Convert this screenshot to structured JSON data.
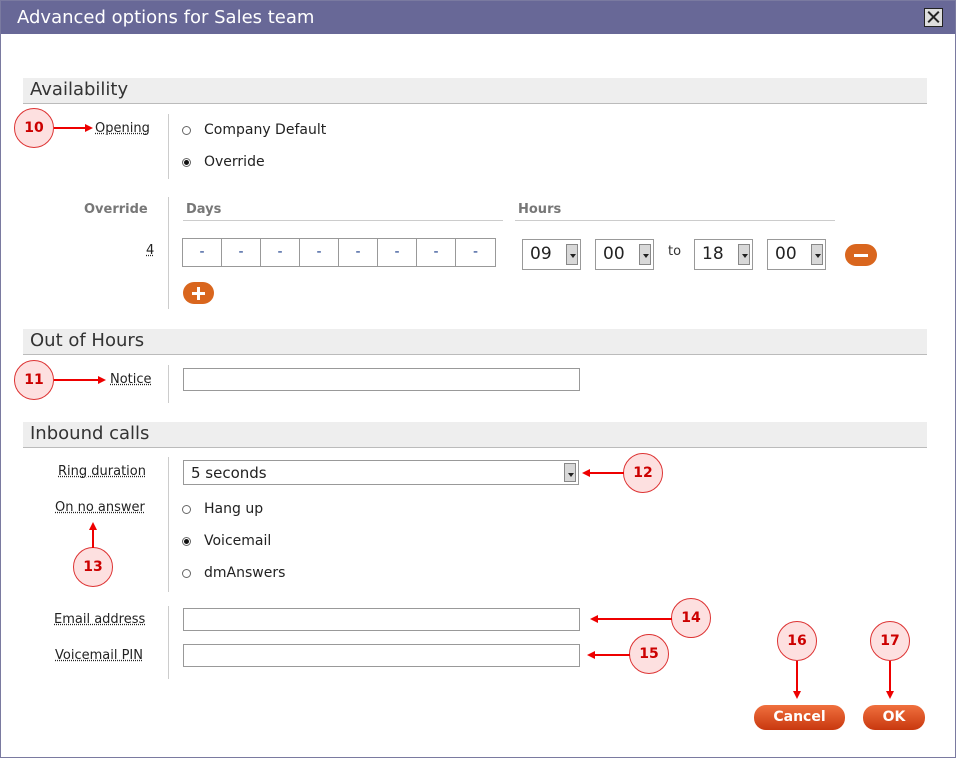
{
  "dialog": {
    "title": "Advanced options for Sales team"
  },
  "availability": {
    "heading": "Availability",
    "opening_label": "Opening",
    "options": [
      "Company Default",
      "Override"
    ],
    "selected": "Override",
    "override_label": "Override",
    "days_header": "Days",
    "hours_header": "Hours",
    "row_number": "4",
    "days": [
      "-",
      "-",
      "-",
      "-",
      "-",
      "-",
      "-",
      "-"
    ],
    "from_hour": "09",
    "from_minute": "00",
    "to_label": "to",
    "to_hour": "18",
    "to_minute": "00"
  },
  "out_of_hours": {
    "heading": "Out of Hours",
    "notice_label": "Notice",
    "notice_value": ""
  },
  "inbound": {
    "heading": "Inbound calls",
    "ring_label": "Ring duration",
    "ring_value": "5 seconds",
    "no_answer_label": "On no answer",
    "options": [
      "Hang up",
      "Voicemail",
      "dmAnswers"
    ],
    "selected": "Voicemail",
    "email_label": "Email address",
    "email_value": "",
    "pin_label": "Voicemail PIN",
    "pin_value": ""
  },
  "buttons": {
    "cancel": "Cancel",
    "ok": "OK"
  },
  "callouts": [
    "10",
    "11",
    "12",
    "13",
    "14",
    "15",
    "16",
    "17"
  ],
  "colors": {
    "titlebar": "#686897",
    "accent": "#d9661e",
    "callout": "#e00000"
  }
}
